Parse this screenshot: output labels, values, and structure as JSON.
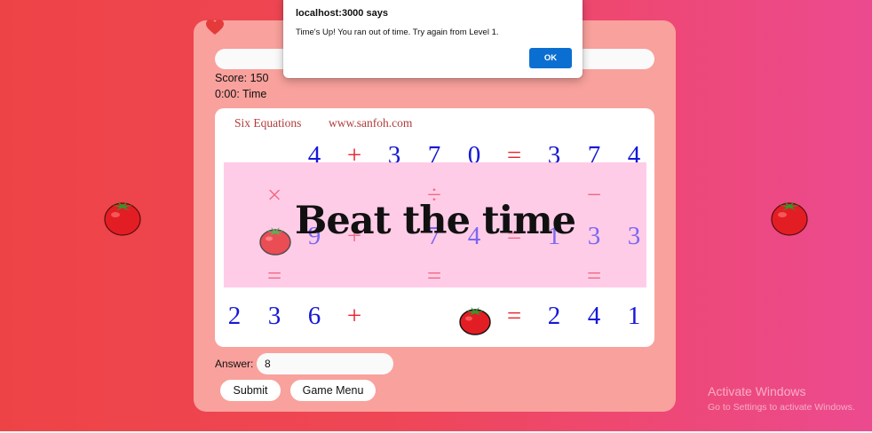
{
  "game": {
    "score_text": "Score: 150",
    "time_text": "0:00: Time",
    "progress_percent": 0
  },
  "puzzle": {
    "title": "Six Equations",
    "site": "www.sanfoh.com",
    "overlay_text": "Beat the time",
    "rows": [
      [
        "",
        "",
        "4",
        "+",
        "3",
        "7",
        "0",
        "=",
        "3",
        "7",
        "4"
      ],
      [
        "",
        "×",
        "",
        "",
        "",
        "÷",
        "",
        "",
        "",
        "−",
        ""
      ],
      [
        "",
        "tomato",
        "9",
        "+",
        "",
        "7",
        "4",
        "=",
        "1",
        "3",
        "3"
      ],
      [
        "",
        "=",
        "",
        "",
        "",
        "=",
        "",
        "",
        "",
        "=",
        ""
      ],
      [
        "2",
        "3",
        "6",
        "+",
        "",
        "",
        "tomato",
        "=",
        "2",
        "4",
        "1"
      ]
    ]
  },
  "answer": {
    "label": "Answer:",
    "value": "8"
  },
  "buttons": {
    "submit": "Submit",
    "game_menu": "Game Menu"
  },
  "dialog": {
    "title": "localhost:3000 says",
    "message": "Time's Up! You ran out of time. Try again from Level 1.",
    "ok": "OK"
  },
  "watermark": {
    "title": "Activate Windows",
    "subtitle": "Go to Settings to activate Windows."
  },
  "colors": {
    "card": "#f9a19c",
    "accent_blue": "#1518d6",
    "accent_red": "#e8232f",
    "dialog_button": "#0b6fd1"
  },
  "icons": {
    "lives": "heart-icon",
    "side": "tomato-icon",
    "puzzle_placeholder": "tomato-icon"
  }
}
